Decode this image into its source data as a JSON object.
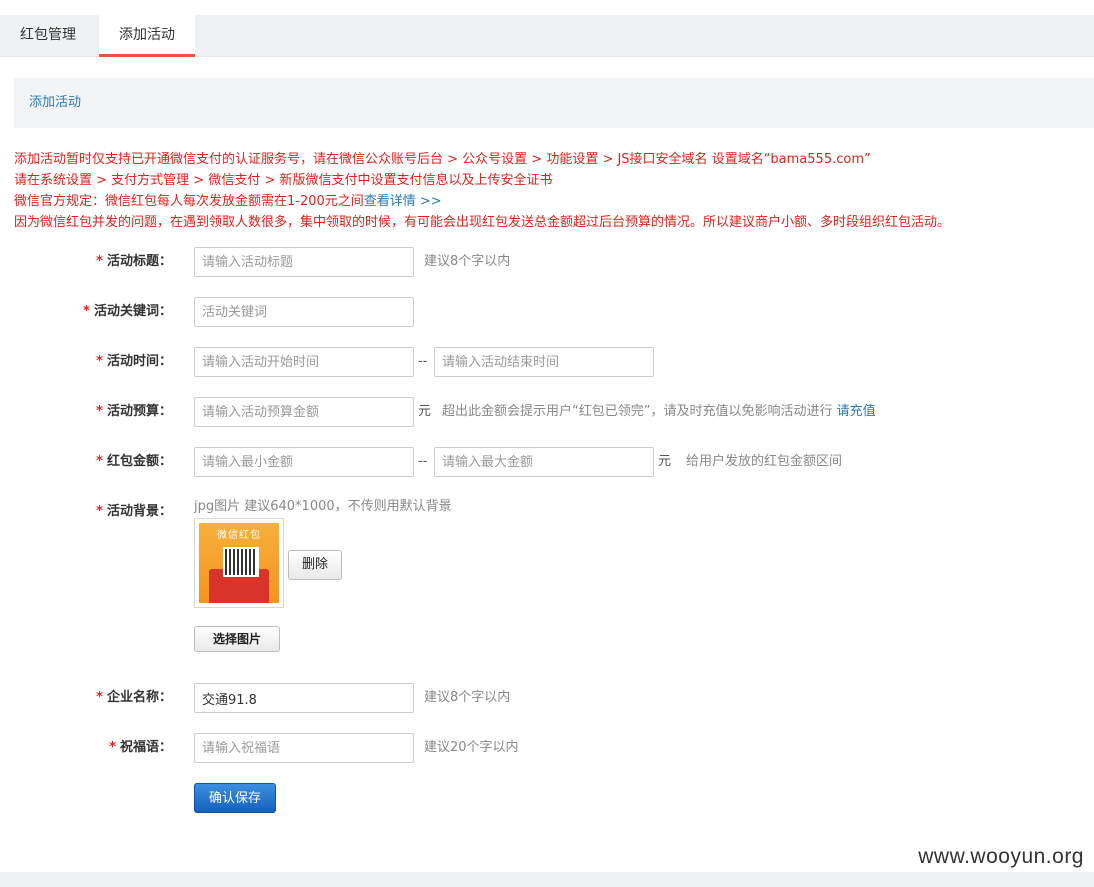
{
  "tabs": [
    {
      "label": "红包管理"
    },
    {
      "label": "添加活动",
      "active": true
    }
  ],
  "section_title": "添加活动",
  "notices": {
    "line1": "添加活动暂时仅支持已开通微信支付的认证服务号，请在微信公众账号后台 > 公众号设置 > 功能设置 > JS接口安全域名 设置域名“bama555.com”",
    "line2": "请在系统设置 > 支付方式管理 > 微信支付 > 新版微信支付中设置支付信息以及上传安全证书",
    "line3": "微信官方规定：微信红包每人每次发放金额需在1-200元之间",
    "line3_link": "查看详情 >>",
    "line4": "因为微信红包并发的问题，在遇到领取人数很多，集中领取的时候，有可能会出现红包发送总金额超过后台预算的情况。所以建议商户小额、多时段组织红包活动。"
  },
  "form": {
    "star": "*",
    "title": {
      "label": "活动标题：",
      "placeholder": "请输入活动标题",
      "hint": "建议8个字以内"
    },
    "keyword": {
      "label": "活动关键词：",
      "placeholder": "活动关键词"
    },
    "time": {
      "label": "活动时间：",
      "start_placeholder": "请输入活动开始时间",
      "separator": "--",
      "end_placeholder": "请输入活动结束时间"
    },
    "budget": {
      "label": "活动预算：",
      "placeholder": "请输入活动预算金额",
      "unit": "元",
      "hint": "超出此金额会提示用户“红包已领完”，请及时充值以免影响活动进行",
      "link": "请充值"
    },
    "amount": {
      "label": "红包金额：",
      "min_placeholder": "请输入最小金额",
      "separator": "--",
      "max_placeholder": "请输入最大金额",
      "unit": "元",
      "hint": "给用户发放的红包金额区间"
    },
    "background": {
      "label": "活动背景：",
      "hint": "jpg图片 建议640*1000，不传则用默认背景",
      "thumb_title": "微信红包",
      "delete_label": "删除",
      "choose_label": "选择图片"
    },
    "company": {
      "label": "企业名称：",
      "value": "交通91.8",
      "hint": "建议8个字以内"
    },
    "blessing": {
      "label": "祝福语：",
      "placeholder": "请输入祝福语",
      "hint": "建议20个字以内"
    },
    "save_label": "确认保存"
  },
  "watermark": "www.wooyun.org",
  "colors": {
    "accent": "#e9553b",
    "link": "#2a7ab5",
    "warning": "#e2211c",
    "primary_button": "#1561bd"
  }
}
